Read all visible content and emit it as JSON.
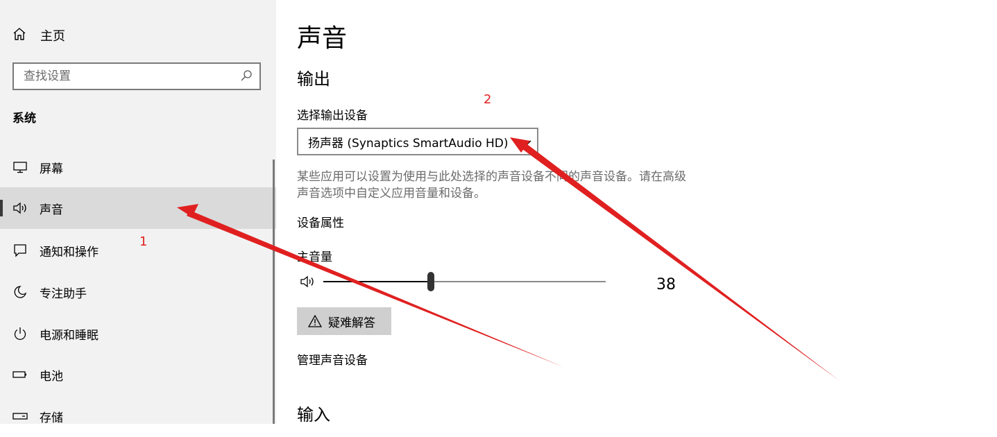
{
  "sidebar": {
    "home_label": "主页",
    "search_placeholder": "查找设置",
    "section_title": "系统",
    "items": [
      {
        "label": "屏幕",
        "icon": "monitor-icon"
      },
      {
        "label": "声音",
        "icon": "speaker-icon",
        "active": true
      },
      {
        "label": "通知和操作",
        "icon": "notification-icon"
      },
      {
        "label": "专注助手",
        "icon": "moon-icon"
      },
      {
        "label": "电源和睡眠",
        "icon": "power-icon"
      },
      {
        "label": "电池",
        "icon": "battery-icon"
      },
      {
        "label": "存储",
        "icon": "storage-icon"
      }
    ]
  },
  "main": {
    "title": "声音",
    "output_heading": "输出",
    "select_output_label": "选择输出设备",
    "output_device": "扬声器 (Synaptics SmartAudio HD)",
    "description": "某些应用可以设置为使用与此处选择的声音设备不同的声音设备。请在高级声音选项中自定义应用音量和设备。",
    "device_properties_link": "设备属性",
    "master_volume_label": "主音量",
    "volume": 38,
    "volume_text": "38",
    "troubleshoot_label": "疑难解答",
    "manage_devices_link": "管理声音设备",
    "input_heading": "输入"
  },
  "annotations": {
    "label_1": "1",
    "label_2": "2",
    "color": "#e02020"
  }
}
